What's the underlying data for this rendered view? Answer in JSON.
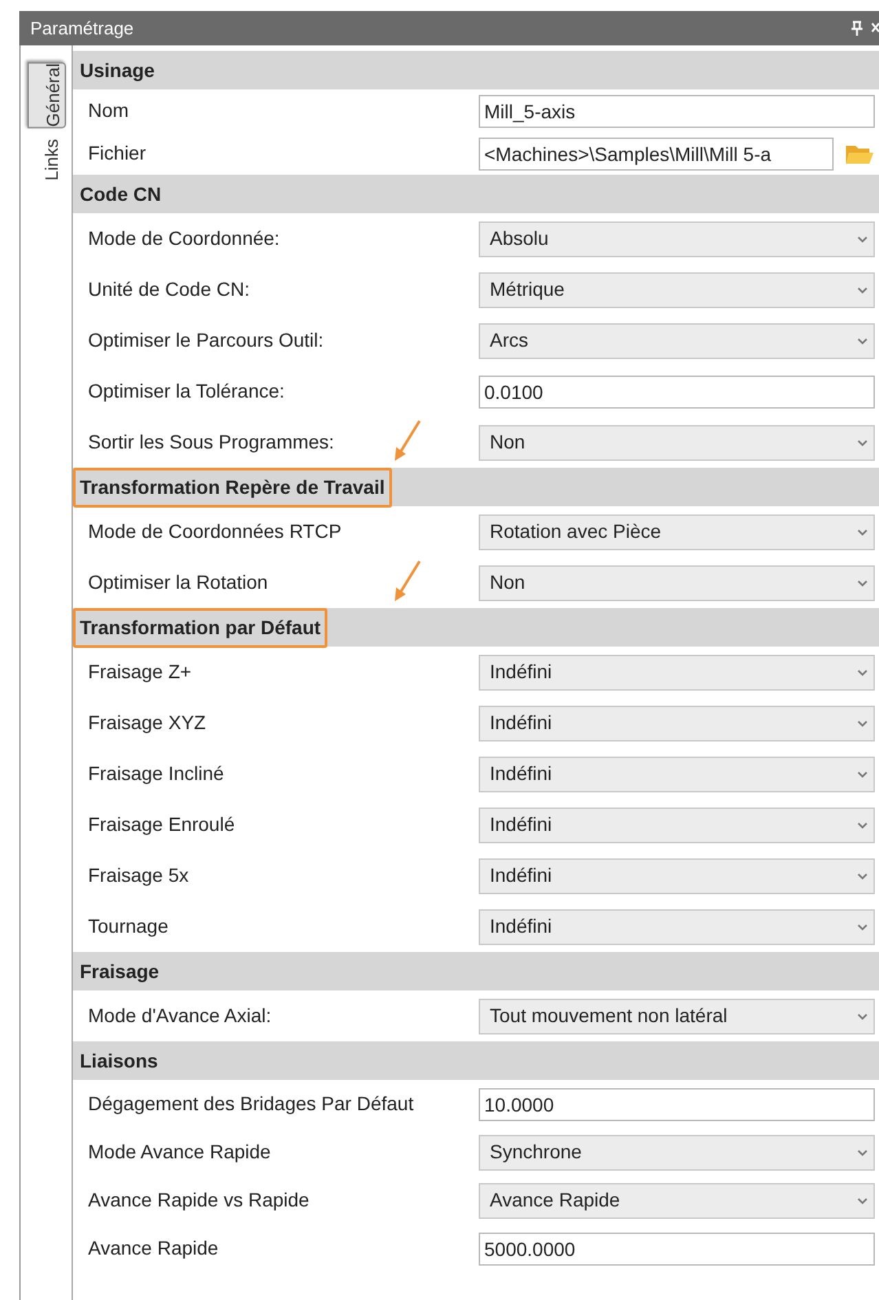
{
  "window": {
    "title": "Paramétrage"
  },
  "side_tabs": [
    {
      "label": "Général",
      "selected": true
    },
    {
      "label": "Links",
      "selected": false
    }
  ],
  "sections": [
    {
      "title": "Usinage",
      "highlighted": false,
      "rows": [
        {
          "label": "Nom",
          "kind": "text",
          "value": "Mill_5-axis"
        },
        {
          "label": "Fichier",
          "kind": "file",
          "value": "<Machines>\\Samples\\Mill\\Mill 5-a"
        }
      ]
    },
    {
      "title": "Code CN",
      "highlighted": false,
      "rows": [
        {
          "label": "Mode de Coordonnée:",
          "kind": "dropdown",
          "value": "Absolu"
        },
        {
          "label": "Unité de Code CN:",
          "kind": "dropdown",
          "value": "Métrique"
        },
        {
          "label": "Optimiser le Parcours Outil:",
          "kind": "dropdown",
          "value": "Arcs"
        },
        {
          "label": "Optimiser la Tolérance:",
          "kind": "text",
          "value": "0.0100"
        },
        {
          "label": "Sortir les Sous Programmes:",
          "kind": "dropdown",
          "value": "Non"
        }
      ]
    },
    {
      "title": "Transformation Repère de Travail",
      "highlighted": true,
      "rows": [
        {
          "label": "Mode de Coordonnées RTCP",
          "kind": "dropdown",
          "value": "Rotation avec Pièce"
        },
        {
          "label": "Optimiser la Rotation",
          "kind": "dropdown",
          "value": "Non"
        }
      ]
    },
    {
      "title": "Transformation par Défaut",
      "highlighted": true,
      "rows": [
        {
          "label": "Fraisage Z+",
          "kind": "dropdown",
          "value": "Indéfini"
        },
        {
          "label": "Fraisage XYZ",
          "kind": "dropdown",
          "value": "Indéfini"
        },
        {
          "label": "Fraisage Incliné",
          "kind": "dropdown",
          "value": "Indéfini"
        },
        {
          "label": "Fraisage Enroulé",
          "kind": "dropdown",
          "value": "Indéfini"
        },
        {
          "label": "Fraisage 5x",
          "kind": "dropdown",
          "value": "Indéfini"
        },
        {
          "label": "Tournage",
          "kind": "dropdown",
          "value": "Indéfini"
        }
      ]
    },
    {
      "title": "Fraisage",
      "highlighted": false,
      "rows": [
        {
          "label": "Mode d'Avance Axial:",
          "kind": "dropdown",
          "value": "Tout mouvement non latéral"
        }
      ]
    },
    {
      "title": "Liaisons",
      "highlighted": false,
      "rows": [
        {
          "label": "Dégagement des Bridages Par Défaut",
          "kind": "text",
          "value": "10.0000"
        },
        {
          "label": "Mode Avance Rapide",
          "kind": "dropdown",
          "value": "Synchrone"
        },
        {
          "label": "Avance Rapide vs Rapide",
          "kind": "dropdown",
          "value": "Avance Rapide"
        },
        {
          "label": "Avance Rapide",
          "kind": "text",
          "value": "5000.0000"
        }
      ]
    }
  ]
}
